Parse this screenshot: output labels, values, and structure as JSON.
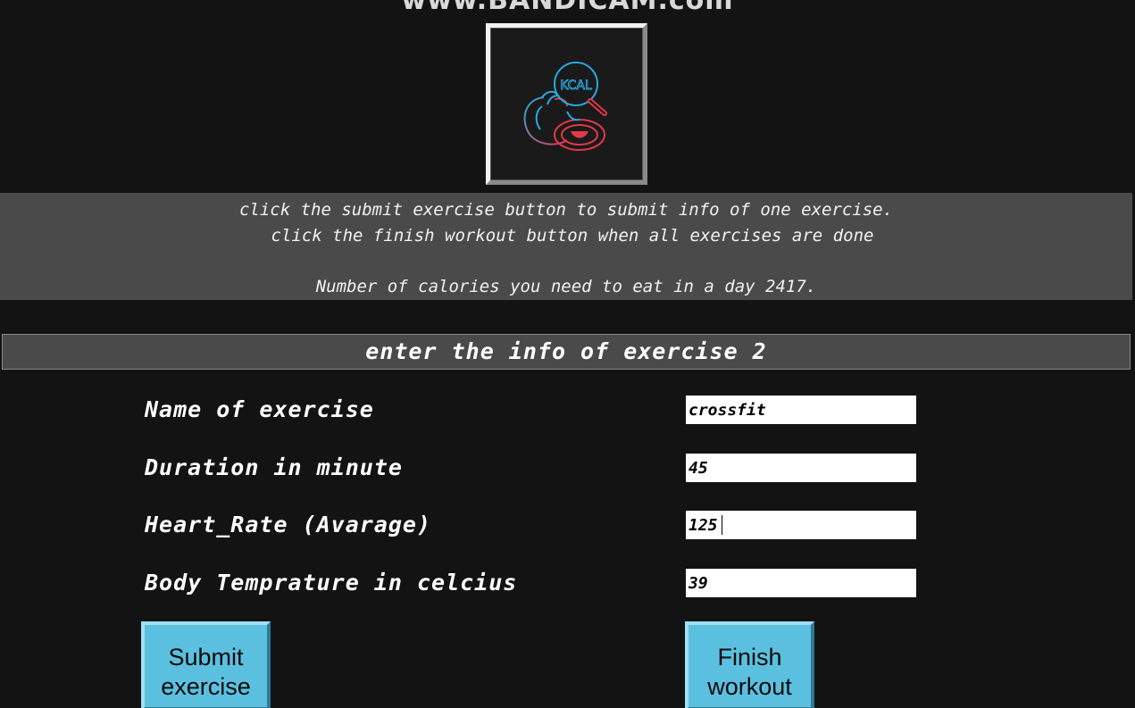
{
  "watermark": "www.BANDICAM.com",
  "logo": {
    "label": "KCAL",
    "icon": "kcal-tomato-icon",
    "colors": {
      "blue": "#2aa9e0",
      "red": "#e2384a"
    }
  },
  "instructions": {
    "line1": "click the submit exercise button to submit info of one exercise.",
    "line2": "click the finish workout button when all exercises are done",
    "line3": "Number of calories you need to eat in a day 2417."
  },
  "section_title": "enter the info of exercise 2",
  "form": {
    "fields": [
      {
        "label": "Name of exercise",
        "value": "crossfit"
      },
      {
        "label": "Duration in minute",
        "value": "45"
      },
      {
        "label": "Heart_Rate (Avarage)",
        "value": "125"
      },
      {
        "label": "Body Temprature in celcius",
        "value": "39"
      }
    ]
  },
  "buttons": {
    "submit": {
      "line1": "Submit",
      "line2": "exercise"
    },
    "finish": {
      "line1": "Finish",
      "line2": "workout"
    }
  },
  "colors": {
    "background": "#131313",
    "panel": "#4a4a4a",
    "button": "#5bc0e0"
  }
}
